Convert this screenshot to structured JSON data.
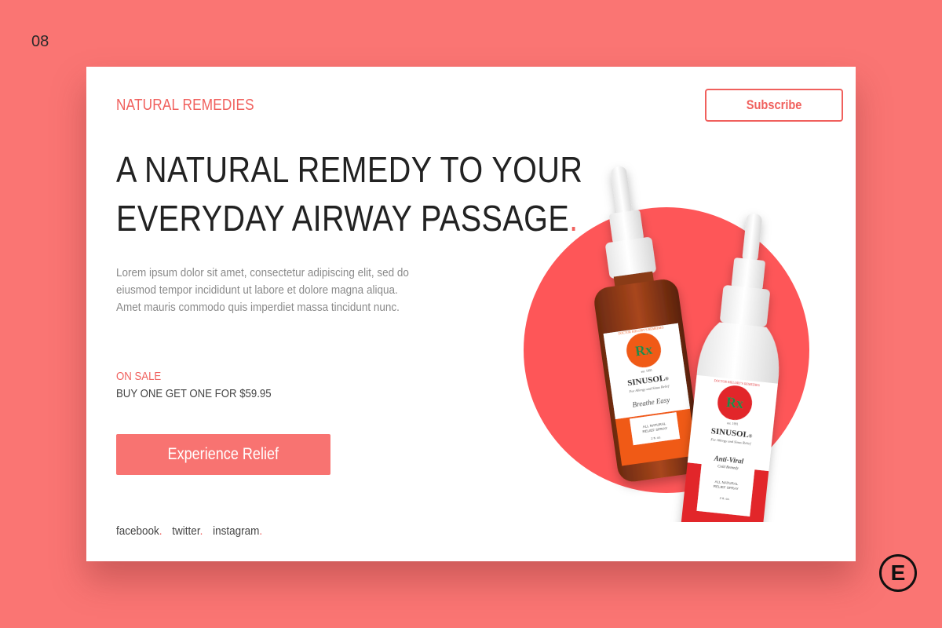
{
  "page_number": "08",
  "brand_mark": "E",
  "header": {
    "eyebrow": "NATURAL REMEDIES",
    "subscribe_label": "Subscribe"
  },
  "hero": {
    "headline_line1": "A NATURAL REMEDY TO YOUR",
    "headline_line2": "EVERYDAY AIRWAY PASSAGE",
    "headline_accent": ".",
    "body": "Lorem ipsum dolor sit amet, consectetur adipiscing elit, sed do eiusmod tempor incididunt ut labore et dolore magna aliqua. Amet mauris commodo quis imperdiet massa tincidunt nunc.",
    "sale_label": "ON SALE",
    "sale_text": "BUY ONE GET ONE FOR $59.95",
    "cta_label": "Experience Relief"
  },
  "social": [
    {
      "label": "facebook",
      "sep": "."
    },
    {
      "label": "twitter",
      "sep": "."
    },
    {
      "label": "instagram",
      "sep": "."
    }
  ],
  "products": [
    {
      "brand": "SINUSOL",
      "registered": "®",
      "rx": "Rx",
      "est": "est. 1991",
      "arc_text": "DOCTOR BIELORY'S REMEDIES",
      "tagline": "For Allergy and Sinus Relief",
      "variant": "Breathe Easy",
      "subvariant": "",
      "claim_line1": "ALL NATURAL",
      "claim_line2": "RELIEF SPRAY",
      "size": "2 fl. oz.",
      "band_color": "#f05a14"
    },
    {
      "brand": "SINUSOL",
      "registered": "®",
      "rx": "Rx",
      "est": "est. 1991",
      "arc_text": "DOCTOR BIELORY'S REMEDIES",
      "tagline": "For Allergy and Sinus Relief",
      "variant": "Anti-Viral",
      "subvariant": "Cold Remedy",
      "claim_line1": "ALL NATURAL",
      "claim_line2": "RELIEF SPRAY",
      "size": "2 fl. oz.",
      "band_color": "#e2262c"
    }
  ],
  "colors": {
    "background": "#fa7573",
    "accent": "#f0605d",
    "circle": "#fe5658",
    "text_dark": "#222222",
    "text_muted": "#8a8a8a"
  }
}
